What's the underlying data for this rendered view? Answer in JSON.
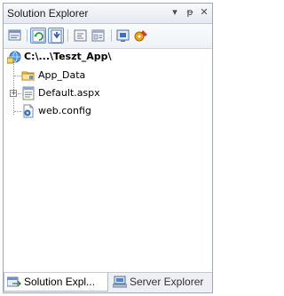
{
  "window": {
    "title": "Solution Explorer"
  },
  "title_buttons": [
    "▾",
    "ᵽ",
    "✕"
  ],
  "toolbar": {
    "tools": [
      {
        "name": "properties-icon",
        "active": false
      },
      {
        "name": "refresh-icon",
        "active": true
      },
      {
        "name": "nest-related-files-icon",
        "active": true
      },
      {
        "name": "view-code-icon",
        "active": false
      },
      {
        "name": "view-designer-icon",
        "active": false
      },
      {
        "name": "copy-website-icon",
        "active": false
      },
      {
        "name": "asp-net-configuration-icon",
        "active": false
      }
    ]
  },
  "tree": {
    "root": {
      "label": "C:\\...\\Teszt_App\\",
      "icon": "web-project-icon"
    },
    "children": [
      {
        "label": "App_Data",
        "icon": "folder-icon",
        "expandable": false
      },
      {
        "label": "Default.aspx",
        "icon": "aspx-page-icon",
        "expandable": true,
        "expander_symbol": "+"
      },
      {
        "label": "web.config",
        "icon": "config-file-icon",
        "expandable": false
      }
    ]
  },
  "tabs": [
    {
      "label": "Solution Expl...",
      "icon": "solution-explorer-icon",
      "selected": true
    },
    {
      "label": "Server Explorer",
      "icon": "server-explorer-icon",
      "selected": false
    }
  ]
}
